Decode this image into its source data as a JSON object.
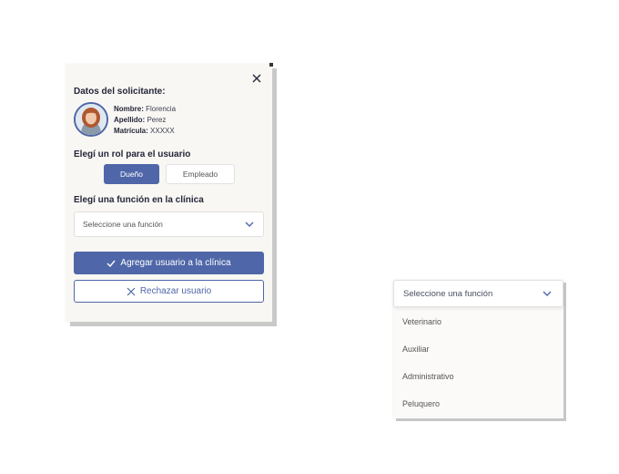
{
  "modal": {
    "title": "Datos del solicitante:",
    "applicant": {
      "name_label": "Nombre:",
      "name_value": "Florencia",
      "surname_label": "Apellido:",
      "surname_value": "Perez",
      "license_label": "Matrícula:",
      "license_value": "XXXXX"
    },
    "role_title": "Elegí un rol para el  usuario",
    "roles": {
      "owner": "Dueño",
      "employee": "Empleado"
    },
    "selected_role": "Dueño",
    "function_title": "Elegí una función en la clínica",
    "function_select": {
      "placeholder": "Seleccione una función"
    },
    "primary_button": "Agregar usuario a la clínica",
    "secondary_button": "Rechazar usuario",
    "icons": {
      "close": "close-icon",
      "check": "check-icon",
      "reject": "x-icon",
      "chevron": "chevron-down-icon"
    }
  },
  "dropdown": {
    "placeholder": "Seleccione una función",
    "options": [
      "Veterinario",
      "Auxiliar",
      "Administrativo",
      "Peluquero"
    ]
  },
  "colors": {
    "accent": "#4f67a8",
    "panel": "#f9f7f3",
    "text": "#23263a"
  }
}
